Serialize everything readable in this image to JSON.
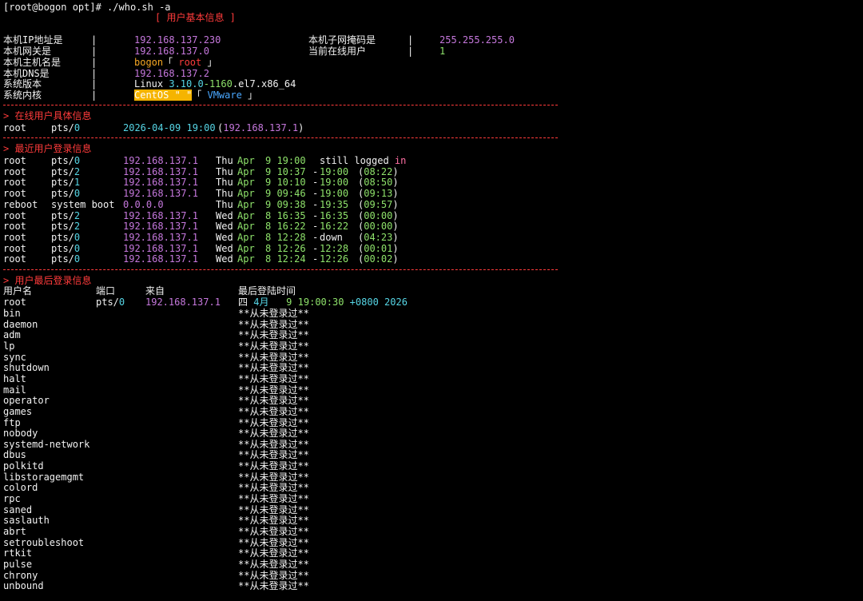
{
  "prompt": {
    "text": "[root@bogon opt]# ./who.sh -a"
  },
  "title": "[ 用户基本信息 ]",
  "basic": {
    "ip_label": "本机IP地址是",
    "ip": "192.168.137.230",
    "mask_label": "本机子网掩码是",
    "mask": "255.255.255.0",
    "gw_label": "本机网关是",
    "gw": "192.168.137.0",
    "online_label": "当前在线用户",
    "online": "1",
    "host_label": "本机主机名是",
    "host": "bogon",
    "host_user": "root",
    "dns_label": "本机DNS是",
    "dns": "192.168.137.2",
    "ver_label": "系统版本",
    "ver_a": "Linux ",
    "ver_b": "3.10.0",
    "ver_c": "-1160",
    "ver_d": ".el7.x86_64",
    "kernel_label": "系统内核",
    "kernel_os": "CentOS \" \"",
    "kernel_vm": "VMware",
    "sep": "|"
  },
  "online_section": {
    "title": "> 在线用户具体信息",
    "row": {
      "user": "root",
      "tty": "pts/0",
      "time": "2026-04-09 19:00",
      "ip": "192.168.137.1"
    }
  },
  "last_section": {
    "title": "> 最近用户登录信息",
    "rows": [
      {
        "user": "root",
        "tty": "pts/0",
        "ip": "192.168.137.1",
        "day": "Thu",
        "mon": "Apr",
        "date": "9 19:00",
        "end": "still logged in",
        "dur": ""
      },
      {
        "user": "root",
        "tty": "pts/2",
        "ip": "192.168.137.1",
        "day": "Thu",
        "mon": "Apr",
        "date": "9 10:37",
        "end": "19:00",
        "dur": "(08:22)"
      },
      {
        "user": "root",
        "tty": "pts/1",
        "ip": "192.168.137.1",
        "day": "Thu",
        "mon": "Apr",
        "date": "9 10:10",
        "end": "19:00",
        "dur": "(08:50)"
      },
      {
        "user": "root",
        "tty": "pts/0",
        "ip": "192.168.137.1",
        "day": "Thu",
        "mon": "Apr",
        "date": "9 09:46",
        "end": "19:00",
        "dur": "(09:13)"
      },
      {
        "user": "reboot",
        "tty": "system boot",
        "ip": "0.0.0.0",
        "day": "Thu",
        "mon": "Apr",
        "date": "9 09:38",
        "end": "19:35",
        "dur": "(09:57)"
      },
      {
        "user": "root",
        "tty": "pts/2",
        "ip": "192.168.137.1",
        "day": "Wed",
        "mon": "Apr",
        "date": "8 16:35",
        "end": "16:35",
        "dur": "(00:00)"
      },
      {
        "user": "root",
        "tty": "pts/2",
        "ip": "192.168.137.1",
        "day": "Wed",
        "mon": "Apr",
        "date": "8 16:22",
        "end": "16:22",
        "dur": "(00:00)"
      },
      {
        "user": "root",
        "tty": "pts/0",
        "ip": "192.168.137.1",
        "day": "Wed",
        "mon": "Apr",
        "date": "8 12:28",
        "end": "down",
        "dur": "(04:23)"
      },
      {
        "user": "root",
        "tty": "pts/0",
        "ip": "192.168.137.1",
        "day": "Wed",
        "mon": "Apr",
        "date": "8 12:26",
        "end": "12:28",
        "dur": "(00:01)"
      },
      {
        "user": "root",
        "tty": "pts/0",
        "ip": "192.168.137.1",
        "day": "Wed",
        "mon": "Apr",
        "date": "8 12:24",
        "end": "12:26",
        "dur": "(00:02)"
      }
    ]
  },
  "lastlog_section": {
    "title": "> 用户最后登录信息",
    "headers": {
      "user": "用户名",
      "port": "端口",
      "from": "来自",
      "latest": "最后登陆时间"
    },
    "root_row": {
      "user": "root",
      "port": "pts/0",
      "from": "192.168.137.1",
      "wk": "四",
      "mon": "4月",
      "day": "9",
      "time": "19:00:30",
      "tz": "+0800",
      "year": "2026"
    },
    "never": "**从未登录过**",
    "users": [
      "bin",
      "daemon",
      "adm",
      "lp",
      "sync",
      "shutdown",
      "halt",
      "mail",
      "operator",
      "games",
      "ftp",
      "nobody",
      "systemd-network",
      "dbus",
      "polkitd",
      "libstoragemgmt",
      "colord",
      "rpc",
      "saned",
      "saslauth",
      "abrt",
      "setroubleshoot",
      "rtkit",
      "pulse",
      "chrony",
      "unbound"
    ]
  },
  "colors": {
    "bg": "#000000",
    "red": "#ff3b3b",
    "purple": "#c678dd",
    "green": "#8fe36b",
    "cyan": "#56d6e6",
    "orange": "#f5a623",
    "blue": "#4aa8ff",
    "pink": "#ff6fa3"
  }
}
